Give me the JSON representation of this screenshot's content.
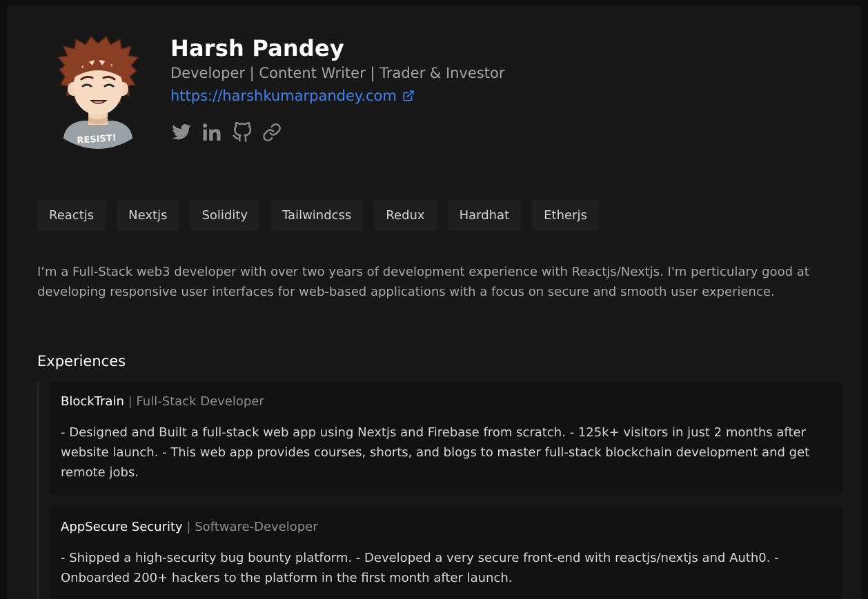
{
  "profile": {
    "name": "Harsh Pandey",
    "subtitle": "Developer | Content Writer | Trader & Investor",
    "website": "https://harshkumarpandey.com",
    "avatar_badge": "RESIST!",
    "socials": [
      {
        "icon": "twitter-icon"
      },
      {
        "icon": "linkedin-icon"
      },
      {
        "icon": "github-icon"
      },
      {
        "icon": "link-icon"
      }
    ]
  },
  "skills": [
    "Reactjs",
    "Nextjs",
    "Solidity",
    "Tailwindcss",
    "Redux",
    "Hardhat",
    "Etherjs"
  ],
  "bio": "I’m a Full-Stack web3 developer with over two years of development experience with Reactjs/Nextjs. I'm perticulary good at developing responsive user interfaces for web-based applications with a focus on secure and smooth user experience.",
  "experiences_heading": "Experiences",
  "experiences": [
    {
      "company": "BlockTrain",
      "separator": "|",
      "role": "Full-Stack Developer",
      "description": "- Designed and Built a full-stack web app using Nextjs and Firebase from scratch. - 125k+ visitors in just 2 months after website launch. - This web app provides courses, shorts, and blogs to master full-stack blockchain development and get remote jobs."
    },
    {
      "company": "AppSecure Security",
      "separator": "|",
      "role": "Software-Developer",
      "description": "- Shipped a high-security bug bounty platform. - Developed a very secure front-end with reactjs/nextjs and Auth0. - Onboarded 200+ hackers to the platform in the first month after launch."
    }
  ],
  "colors": {
    "background": "#181818",
    "link": "#3d82f5",
    "tag_background": "#1f1f1f",
    "card_background": "#121212"
  }
}
